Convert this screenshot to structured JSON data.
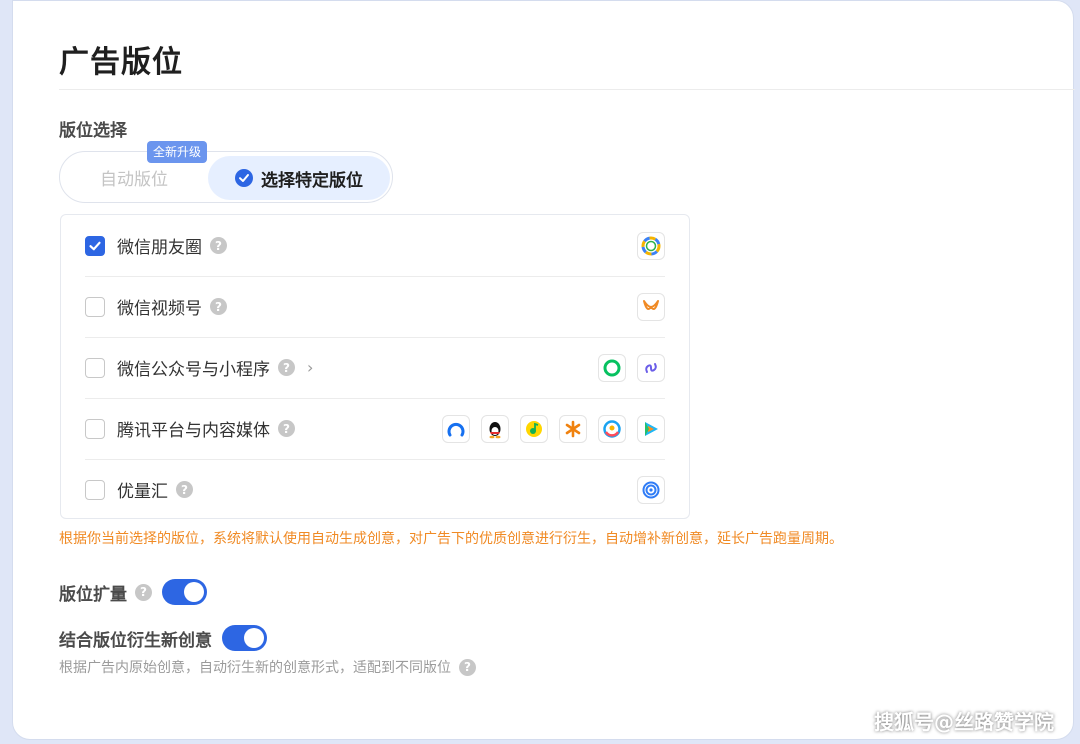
{
  "page": {
    "title": "广告版位"
  },
  "placement": {
    "section_label": "版位选择",
    "badge": "全新升级",
    "modes": {
      "auto": "自动版位",
      "specific": "选择特定版位"
    },
    "options": [
      {
        "label": "微信朋友圈",
        "checked": true,
        "icons": [
          "moments-icon"
        ]
      },
      {
        "label": "微信视频号",
        "checked": false,
        "icons": [
          "channels-icon"
        ]
      },
      {
        "label": "微信公众号与小程序",
        "checked": false,
        "has_chevron": true,
        "icons": [
          "official-account-icon",
          "mini-program-icon"
        ]
      },
      {
        "label": "腾讯平台与内容媒体",
        "checked": false,
        "icons": [
          "tencent-news-icon",
          "qq-icon",
          "qq-music-icon",
          "kuaibao-icon",
          "tencent-news-app-icon",
          "tencent-video-icon"
        ]
      },
      {
        "label": "优量汇",
        "checked": false,
        "icons": [
          "youlianghui-icon"
        ]
      }
    ],
    "notice": "根据你当前选择的版位，系统将默认使用自动生成创意，对广告下的优质创意进行衍生，自动增补新创意，延长广告跑量周期。"
  },
  "settings": {
    "expansion_label": "版位扩量",
    "expansion_enabled": true,
    "derive_label": "结合版位衍生新创意",
    "derive_enabled": true,
    "derive_desc": "根据广告内原始创意，自动衍生新的创意形式，适配到不同版位"
  },
  "watermark": "搜狐号@丝路赞学院",
  "colors": {
    "primary": "#2d66e3",
    "notice": "#f08a24",
    "selected_bg": "#e6efff"
  }
}
